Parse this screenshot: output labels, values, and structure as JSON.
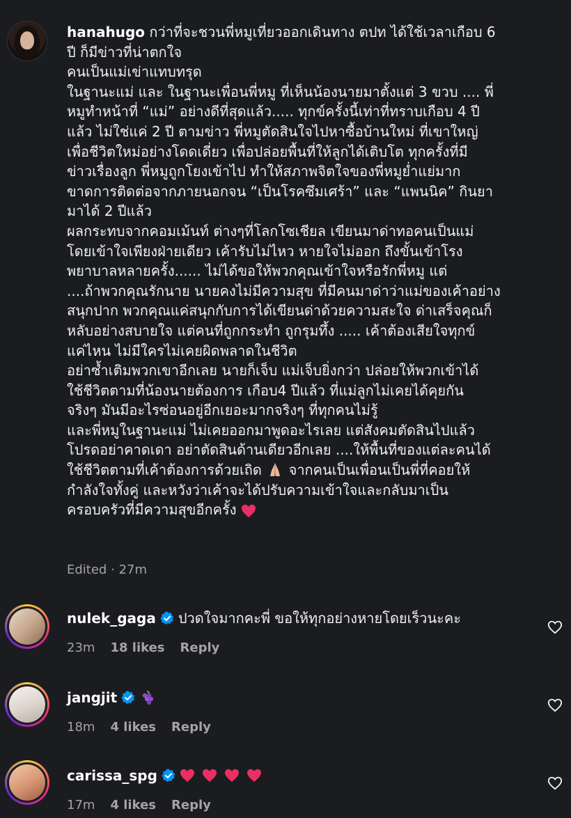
{
  "post": {
    "username": "hanahugo",
    "lines": [
      "กว่าที่จะชวนพี่หมูเที่ยวออกเดินทาง ตปท ได้ใช้เวลาเกือบ 6",
      "ปี ก็มีข่าวที่น่าตกใจ",
      "คนเป็นแม่เข่าแทบทรุด",
      "ในฐานะแม่ และ ในฐานะเพื่อนพี่หมู ที่เห็นน้องนายมาตั้งแต่ 3 ขวบ .... พี่",
      "หมูทำหน้าที่ “แม่” อย่างดีที่สุดแล้ว..... ทุกข์ครั้งนี้เท่าที่ทราบเกือบ 4 ปี",
      "แล้ว ไม่ใช่แค่ 2 ปี ตามข่าว พี่หมูตัดสินใจไปหาซื้อบ้านใหม่ ที่เขาใหญ่",
      "เพื่อชีวิตใหม่อย่างโดดเดี่ยว เพื่อปล่อยพื้นที่ให้ลูกได้เติบโต ทุกครั้งที่มี",
      "ข่าวเรื่องลูก พี่หมูถูกโยงเข้าไป ทำให้สภาพจิตใจของพี่หมูย่ำแย่มาก",
      "ขาดการติดต่อจากภายนอกจน “เป็นโรคซึมเศร้า” และ “แพนนิค” กินยา",
      "มาได้ 2 ปีแล้ว",
      "ผลกระทบจากคอมเม้นท์ ต่างๆที่โลกโซเชียล เขียนมาด่าทอคนเป็นแม่",
      "โดยเข้าใจเพียงฝ่ายเดียว เค้ารับไม่ไหว หายใจไม่ออก ถึงขั้นเข้าโรง",
      "พยาบาลหลายครั้ง...... ไม่ได้ขอให้พวกคุณเข้าใจหรือรักพี่หมู แต่",
      "....ถ้าพวกคุณรักนาย นายคงไม่มีความสุข ที่มีคนมาด่าว่าแม่ของเค้าอย่าง",
      "สนุกปาก พวกคุณแค่สนุกกับการได้เขียนด่าด้วยความสะใจ ด่าเสร็จคุณก็",
      "หลับอย่างสบายใจ แต่คนที่ถูกกระทำ ถูกรุมทึ้ง ..... เค้าต้องเสียใจทุกข์",
      "แค่ไหน ไม่มีใครไม่เคยผิดพลาดในชีวิต",
      "อย่าซ้ำเติมพวกเขาอีกเลย นายก็เจ็บ แม่เจ็บยิ่งกว่า ปล่อยให้พวกเข้าได้",
      "ใช้ชีวิตตามที่น้องนายต้องการ เกือบ4 ปีแล้ว ที่แม่ลูกไม่เคยได้คุยกัน",
      "จริงๆ มันมีอะไรซ่อนอยู่อีกเยอะมากจริงๆ ที่ทุกคนไม่รู้",
      "และพี่หมูในฐานะแม่ ไม่เคยออกมาพูดอะไรเลย แต่สังคมตัดสินไปแล้ว",
      "โปรดอย่าคาดเดา อย่าตัดสินด้านเดียวอีกเลย ....ให้พื้นที่ของแต่ละคนได้",
      "ใช้ชีวิตตามที่เค้าต้องการด้วยเถิด",
      "กำลังใจทั้งคู่ และหวังว่าเค้าจะได้ปรับความเข้าใจและกลับมาเป็น",
      "ครอบครัวที่มีความสุขอีกครั้ง"
    ],
    "line_23_after_emoji": "จากคนเป็นเพื่อนเป็นพี่ที่คอยให้",
    "edited": "Edited",
    "dot": "·",
    "time": "27m"
  },
  "comments": [
    {
      "username": "nulek_gaga",
      "verified": true,
      "text": "ปวดใจมากคะพี่ ขอให้ทุกอย่างหายโดยเร็วนะคะ",
      "time": "23m",
      "likes": "18 likes",
      "reply": "Reply",
      "avatar_icon": "avatar-photo"
    },
    {
      "username": "jangjit",
      "verified": true,
      "text": "",
      "emoji_icon": "grapes-icon",
      "time": "18m",
      "likes": "4 likes",
      "reply": "Reply",
      "avatar_icon": "avatar-photo"
    },
    {
      "username": "carissa_spg",
      "verified": true,
      "text": "",
      "emoji_icon": "heart-emoji",
      "time": "17m",
      "likes": "4 likes",
      "reply": "Reply",
      "avatar_icon": "avatar-photo"
    }
  ],
  "colors": {
    "background": "#1b1c20",
    "text": "#f0f0f0",
    "meta": "#a3a3a8",
    "verified": "#0095f6",
    "heart": "#e0245e"
  }
}
